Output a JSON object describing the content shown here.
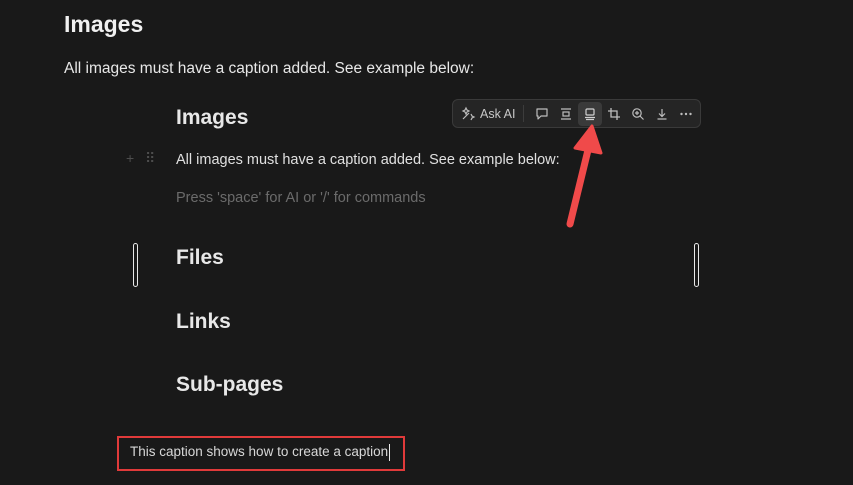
{
  "page": {
    "heading": "Images",
    "paragraph": "All images must have a caption added. See example below:"
  },
  "image": {
    "heading": "Images",
    "paragraph": "All images must have a caption added. See example below:",
    "placeholder": "Press 'space' for AI or '/' for commands",
    "sections": [
      "Files",
      "Links",
      "Sub-pages"
    ],
    "toolbar": {
      "ask_ai_label": "Ask AI",
      "icons": [
        "ai-sparkle-icon",
        "comment-icon",
        "align-center-icon",
        "caption-icon",
        "crop-icon",
        "zoom-in-icon",
        "download-icon",
        "more-icon"
      ]
    }
  },
  "caption": {
    "text": "This caption shows how to create a caption"
  },
  "colors": {
    "background": "#191919",
    "annotation_red": "#e03a3a",
    "arrow_red": "#f04a4a"
  }
}
